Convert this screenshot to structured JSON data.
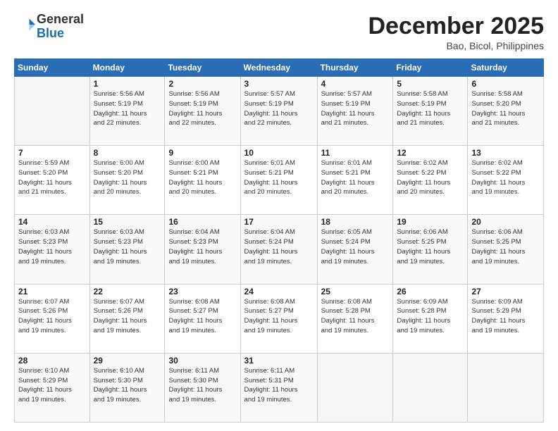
{
  "header": {
    "logo_general": "General",
    "logo_blue": "Blue",
    "title": "December 2025",
    "subtitle": "Bao, Bicol, Philippines"
  },
  "weekdays": [
    "Sunday",
    "Monday",
    "Tuesday",
    "Wednesday",
    "Thursday",
    "Friday",
    "Saturday"
  ],
  "weeks": [
    [
      {
        "day": "",
        "info": ""
      },
      {
        "day": "1",
        "info": "Sunrise: 5:56 AM\nSunset: 5:19 PM\nDaylight: 11 hours\nand 22 minutes."
      },
      {
        "day": "2",
        "info": "Sunrise: 5:56 AM\nSunset: 5:19 PM\nDaylight: 11 hours\nand 22 minutes."
      },
      {
        "day": "3",
        "info": "Sunrise: 5:57 AM\nSunset: 5:19 PM\nDaylight: 11 hours\nand 22 minutes."
      },
      {
        "day": "4",
        "info": "Sunrise: 5:57 AM\nSunset: 5:19 PM\nDaylight: 11 hours\nand 21 minutes."
      },
      {
        "day": "5",
        "info": "Sunrise: 5:58 AM\nSunset: 5:19 PM\nDaylight: 11 hours\nand 21 minutes."
      },
      {
        "day": "6",
        "info": "Sunrise: 5:58 AM\nSunset: 5:20 PM\nDaylight: 11 hours\nand 21 minutes."
      }
    ],
    [
      {
        "day": "7",
        "info": "Sunrise: 5:59 AM\nSunset: 5:20 PM\nDaylight: 11 hours\nand 21 minutes."
      },
      {
        "day": "8",
        "info": "Sunrise: 6:00 AM\nSunset: 5:20 PM\nDaylight: 11 hours\nand 20 minutes."
      },
      {
        "day": "9",
        "info": "Sunrise: 6:00 AM\nSunset: 5:21 PM\nDaylight: 11 hours\nand 20 minutes."
      },
      {
        "day": "10",
        "info": "Sunrise: 6:01 AM\nSunset: 5:21 PM\nDaylight: 11 hours\nand 20 minutes."
      },
      {
        "day": "11",
        "info": "Sunrise: 6:01 AM\nSunset: 5:21 PM\nDaylight: 11 hours\nand 20 minutes."
      },
      {
        "day": "12",
        "info": "Sunrise: 6:02 AM\nSunset: 5:22 PM\nDaylight: 11 hours\nand 20 minutes."
      },
      {
        "day": "13",
        "info": "Sunrise: 6:02 AM\nSunset: 5:22 PM\nDaylight: 11 hours\nand 19 minutes."
      }
    ],
    [
      {
        "day": "14",
        "info": "Sunrise: 6:03 AM\nSunset: 5:23 PM\nDaylight: 11 hours\nand 19 minutes."
      },
      {
        "day": "15",
        "info": "Sunrise: 6:03 AM\nSunset: 5:23 PM\nDaylight: 11 hours\nand 19 minutes."
      },
      {
        "day": "16",
        "info": "Sunrise: 6:04 AM\nSunset: 5:23 PM\nDaylight: 11 hours\nand 19 minutes."
      },
      {
        "day": "17",
        "info": "Sunrise: 6:04 AM\nSunset: 5:24 PM\nDaylight: 11 hours\nand 19 minutes."
      },
      {
        "day": "18",
        "info": "Sunrise: 6:05 AM\nSunset: 5:24 PM\nDaylight: 11 hours\nand 19 minutes."
      },
      {
        "day": "19",
        "info": "Sunrise: 6:06 AM\nSunset: 5:25 PM\nDaylight: 11 hours\nand 19 minutes."
      },
      {
        "day": "20",
        "info": "Sunrise: 6:06 AM\nSunset: 5:25 PM\nDaylight: 11 hours\nand 19 minutes."
      }
    ],
    [
      {
        "day": "21",
        "info": "Sunrise: 6:07 AM\nSunset: 5:26 PM\nDaylight: 11 hours\nand 19 minutes."
      },
      {
        "day": "22",
        "info": "Sunrise: 6:07 AM\nSunset: 5:26 PM\nDaylight: 11 hours\nand 19 minutes."
      },
      {
        "day": "23",
        "info": "Sunrise: 6:08 AM\nSunset: 5:27 PM\nDaylight: 11 hours\nand 19 minutes."
      },
      {
        "day": "24",
        "info": "Sunrise: 6:08 AM\nSunset: 5:27 PM\nDaylight: 11 hours\nand 19 minutes."
      },
      {
        "day": "25",
        "info": "Sunrise: 6:08 AM\nSunset: 5:28 PM\nDaylight: 11 hours\nand 19 minutes."
      },
      {
        "day": "26",
        "info": "Sunrise: 6:09 AM\nSunset: 5:28 PM\nDaylight: 11 hours\nand 19 minutes."
      },
      {
        "day": "27",
        "info": "Sunrise: 6:09 AM\nSunset: 5:29 PM\nDaylight: 11 hours\nand 19 minutes."
      }
    ],
    [
      {
        "day": "28",
        "info": "Sunrise: 6:10 AM\nSunset: 5:29 PM\nDaylight: 11 hours\nand 19 minutes."
      },
      {
        "day": "29",
        "info": "Sunrise: 6:10 AM\nSunset: 5:30 PM\nDaylight: 11 hours\nand 19 minutes."
      },
      {
        "day": "30",
        "info": "Sunrise: 6:11 AM\nSunset: 5:30 PM\nDaylight: 11 hours\nand 19 minutes."
      },
      {
        "day": "31",
        "info": "Sunrise: 6:11 AM\nSunset: 5:31 PM\nDaylight: 11 hours\nand 19 minutes."
      },
      {
        "day": "",
        "info": ""
      },
      {
        "day": "",
        "info": ""
      },
      {
        "day": "",
        "info": ""
      }
    ]
  ]
}
